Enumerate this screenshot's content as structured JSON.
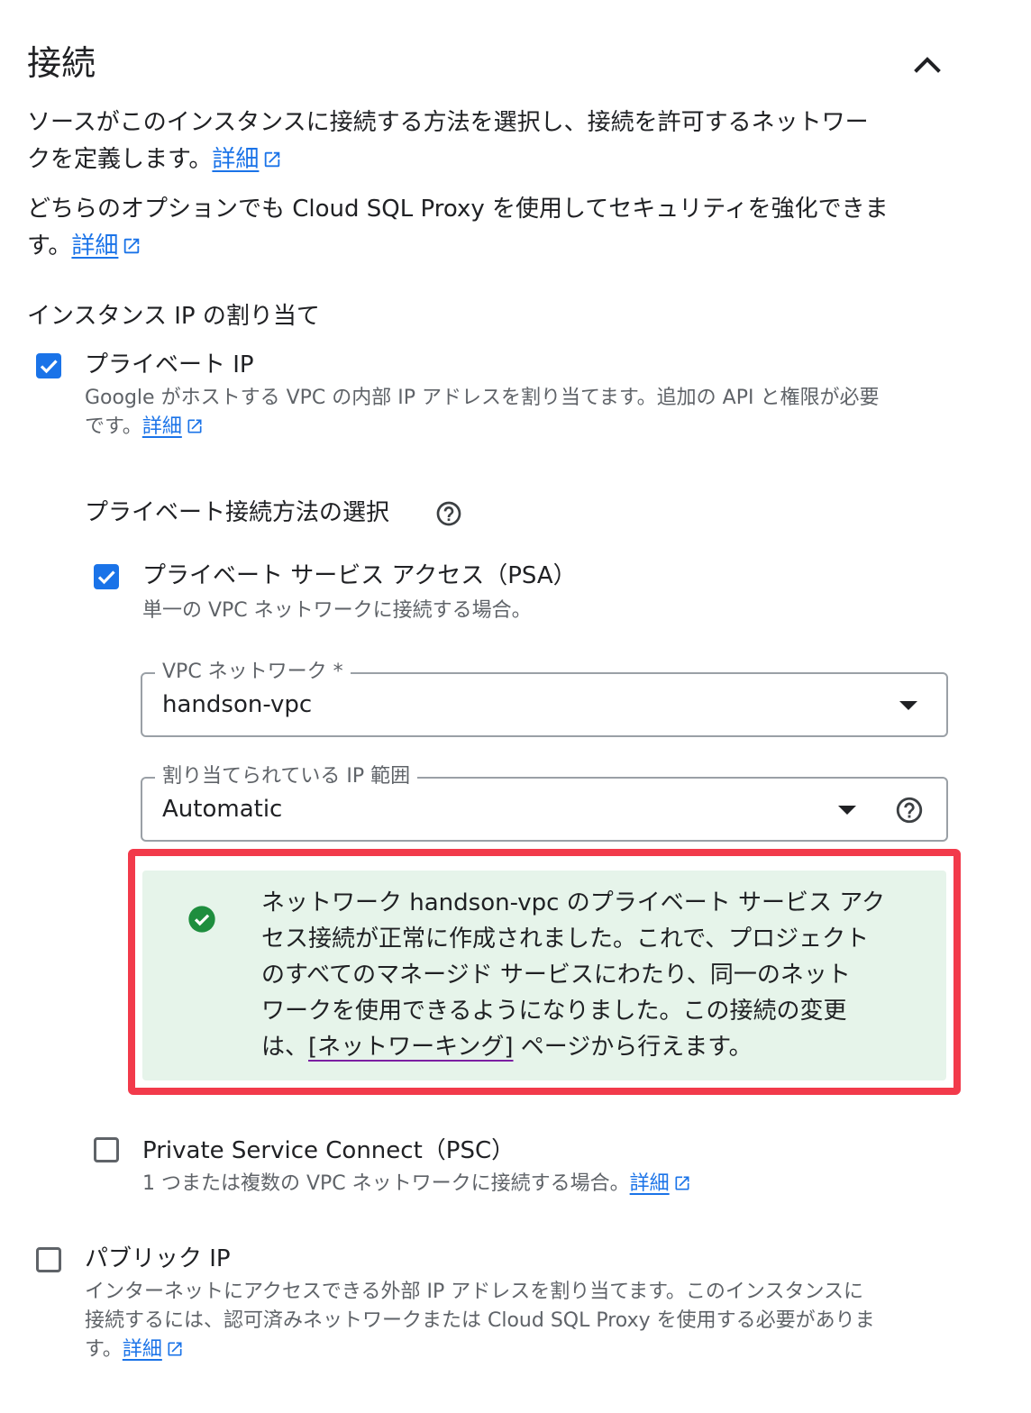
{
  "section": {
    "title": "接続",
    "desc1": "ソースがこのインスタンスに接続する方法を選択し、接続を許可するネットワー",
    "desc1b": "クを定義します。",
    "desc2": "どちらのオプションでも Cloud SQL Proxy を使用してセキュリティを強化できま",
    "desc2b": "す。",
    "learn_more": "詳細"
  },
  "ip_assignment": {
    "label": "インスタンス IP の割り当て",
    "private_ip": {
      "label": "プライベート IP",
      "checked": true,
      "desc1": "Google がホストする VPC の内部 IP アドレスを割り当てます。追加の API と権限が必要",
      "desc2": "です。"
    },
    "private_method_label": "プライベート接続方法の選択",
    "psa": {
      "label": "プライベート サービス アクセス（PSA）",
      "checked": true,
      "desc": "単一の VPC ネットワークに接続する場合。"
    },
    "vpc_network": {
      "label": "VPC ネットワーク *",
      "value": "handson-vpc"
    },
    "ip_range": {
      "label": "割り当てられている IP 範囲",
      "value": "Automatic"
    },
    "success": {
      "line1": "ネットワーク handson-vpc のプライベート サービス アク",
      "line2": "セス接続が正常に作成されました。これで、プロジェクト",
      "line3": "のすべてのマネージド サービスにわたり、同一のネット",
      "line4": "ワークを使用できるようになりました。この接続の変更",
      "line5a": "は、",
      "line5_link": "[ネットワーキング]",
      "line5b": " ページから行えます。"
    },
    "psc": {
      "label": "Private Service Connect（PSC）",
      "checked": false,
      "desc": "1 つまたは複数の VPC ネットワークに接続する場合。"
    },
    "public_ip": {
      "label": "パブリック IP",
      "checked": false,
      "desc1": "インターネットにアクセスできる外部 IP アドレスを割り当てます。このインスタンスに",
      "desc2": "接続するには、認可済みネットワークまたは Cloud SQL Proxy を使用する必要がありま",
      "desc3": "す。"
    }
  },
  "colors": {
    "accent": "#1a73e8",
    "success_bg": "#e6f4ea",
    "success_icon": "#1e8e3e",
    "highlight_border": "#f23a4b"
  }
}
